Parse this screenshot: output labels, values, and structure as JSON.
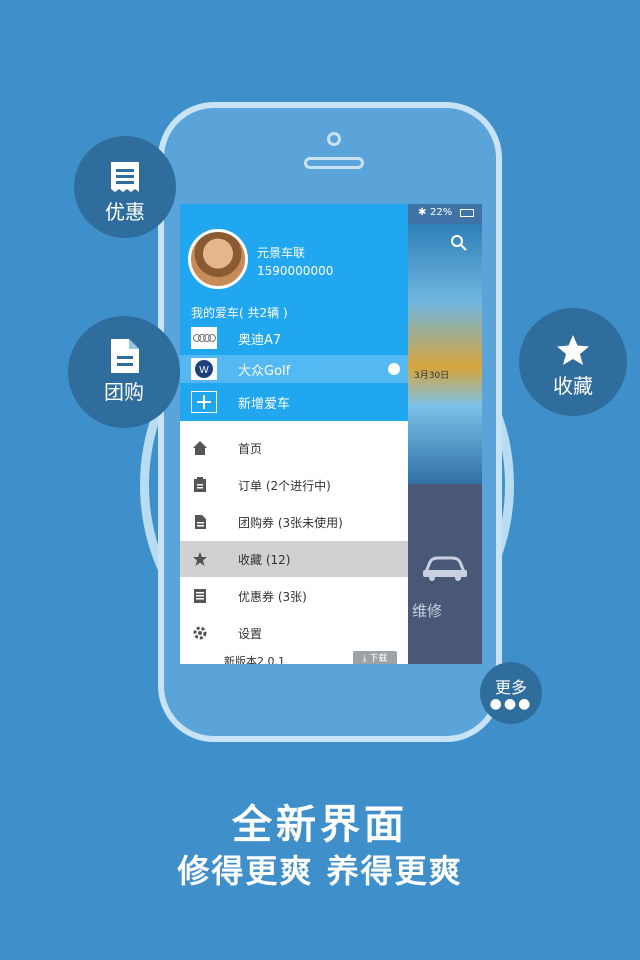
{
  "bubbles": {
    "discount": "优惠",
    "groupbuy": "团购",
    "favorite": "收藏",
    "more": "更多"
  },
  "status_bar": {
    "battery": "22%"
  },
  "app_right": {
    "banner_date": "3月30日",
    "repair_label": "维修"
  },
  "drawer": {
    "user_name": "元景车联",
    "user_phone": "1590000000",
    "my_cars_label": "我的爱车( 共2辆 )",
    "cars": [
      {
        "name": "奥迪A7"
      },
      {
        "name": "大众Golf"
      },
      {
        "name": "新增爱车"
      }
    ],
    "menu": [
      {
        "label": "首页"
      },
      {
        "label": "订单 (2个进行中)"
      },
      {
        "label": "团购券 (3张未使用)"
      },
      {
        "label": "收藏 (12)"
      },
      {
        "label": "优惠券 (3张)"
      },
      {
        "label": "设置"
      }
    ],
    "version": "新版本2.0.1",
    "download": "下载"
  },
  "headline": {
    "title": "全新界面",
    "subtitle": "修得更爽 养得更爽"
  },
  "colors": {
    "background": "#3f8fcb",
    "drawer_header": "#21a7f0",
    "bubble": "#2f6d9d"
  }
}
